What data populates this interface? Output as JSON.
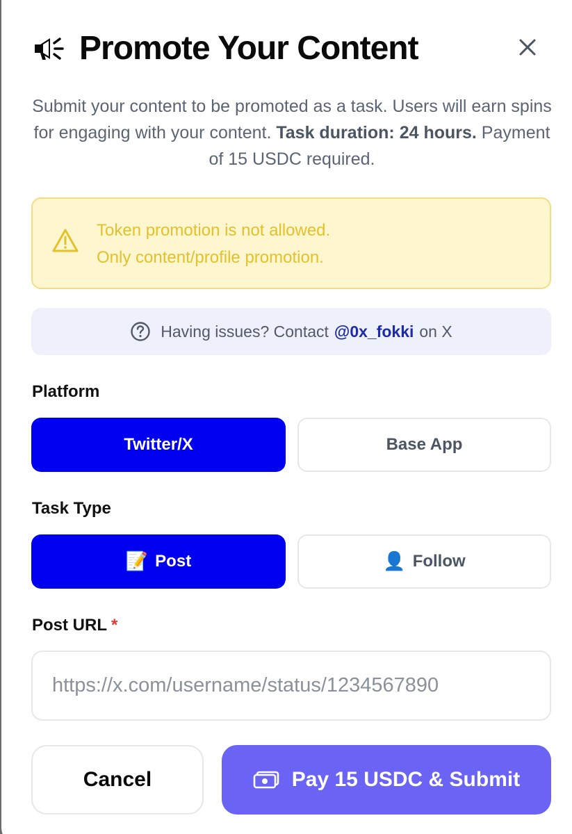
{
  "modal": {
    "title": "Promote Your Content",
    "description_plain_1": "Submit your content to be promoted as a task. Users will earn spins for engaging with your content.",
    "description_bold": "Task duration: 24 hours.",
    "description_plain_2": "Payment of 15 USDC required."
  },
  "warning": {
    "line1": "Token promotion is not allowed.",
    "line2": "Only content/profile promotion."
  },
  "help": {
    "prefix": "Having issues? Contact",
    "handle": "@0x_fokki",
    "suffix": "on X"
  },
  "platform": {
    "label": "Platform",
    "options": [
      {
        "label": "Twitter/X",
        "selected": true
      },
      {
        "label": "Base App",
        "selected": false
      }
    ]
  },
  "task_type": {
    "label": "Task Type",
    "options": [
      {
        "emoji": "📝",
        "label": "Post",
        "selected": true
      },
      {
        "emoji": "👤",
        "label": "Follow",
        "selected": false
      }
    ]
  },
  "post_url": {
    "label": "Post URL",
    "required_mark": "*",
    "value": "",
    "placeholder": "https://x.com/username/status/1234567890"
  },
  "actions": {
    "cancel_label": "Cancel",
    "submit_label": "Pay 15 USDC & Submit"
  },
  "icons": {
    "title_icon": "megaphone-icon",
    "close_icon": "close-icon",
    "warning_icon": "warning-triangle-icon",
    "help_icon": "question-circle-icon",
    "submit_icon": "cash-icon"
  },
  "colors": {
    "primary": "#0000f0",
    "submit": "#6a63f4",
    "warning_bg": "#fdf6cf",
    "warning_text": "#e3c12c",
    "help_bg": "#eef0fb",
    "help_link": "#1e2aa8",
    "required": "#e53935"
  }
}
